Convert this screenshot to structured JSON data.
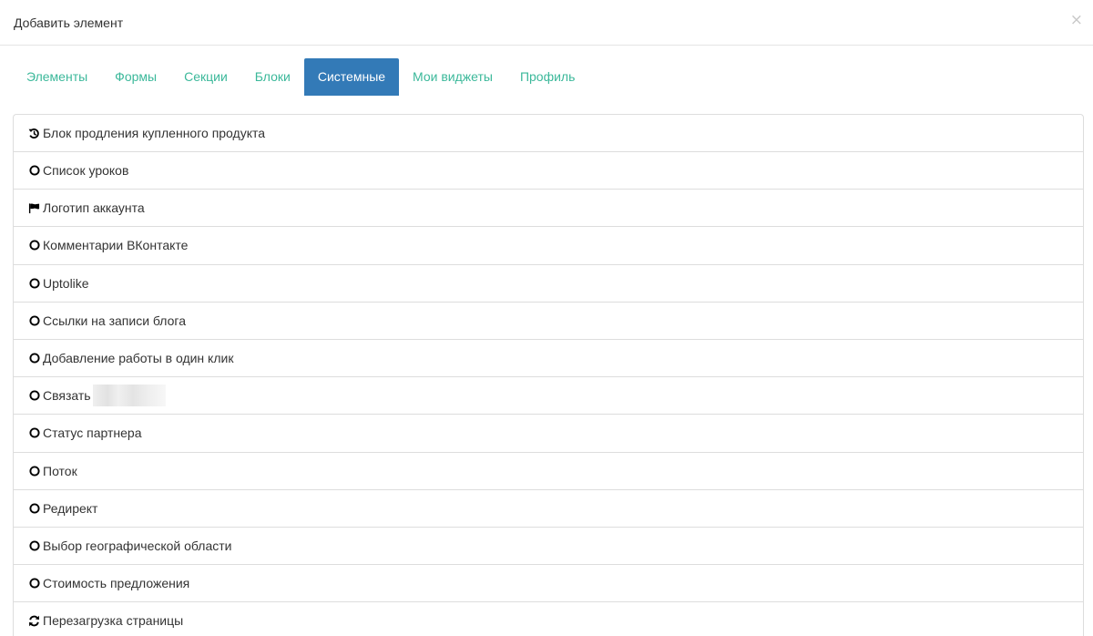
{
  "dialog": {
    "title": "Добавить элемент",
    "close_symbol": "×"
  },
  "tabs": [
    {
      "label": "Элементы",
      "active": false
    },
    {
      "label": "Формы",
      "active": false
    },
    {
      "label": "Секции",
      "active": false
    },
    {
      "label": "Блоки",
      "active": false
    },
    {
      "label": "Системные",
      "active": true
    },
    {
      "label": "Мои виджеты",
      "active": false
    },
    {
      "label": "Профиль",
      "active": false
    }
  ],
  "items": [
    {
      "label": "Блок продления купленного продукта",
      "icon": "history-icon"
    },
    {
      "label": "Список уроков",
      "icon": "circle-icon"
    },
    {
      "label": "Логотип аккаунта",
      "icon": "flag-icon"
    },
    {
      "label": "Комментарии ВКонтакте",
      "icon": "circle-icon"
    },
    {
      "label": "Uptolike",
      "icon": "circle-icon"
    },
    {
      "label": "Ссылки на записи блога",
      "icon": "circle-icon"
    },
    {
      "label": "Добавление работы в один клик",
      "icon": "circle-icon"
    },
    {
      "label": "Связать",
      "icon": "circle-icon",
      "redacted": true
    },
    {
      "label": "Статус партнера",
      "icon": "circle-icon"
    },
    {
      "label": "Поток",
      "icon": "circle-icon"
    },
    {
      "label": "Редирект",
      "icon": "circle-icon"
    },
    {
      "label": "Выбор географической области",
      "icon": "circle-icon"
    },
    {
      "label": "Стоимость предложения",
      "icon": "circle-icon"
    },
    {
      "label": "Перезагрузка страницы",
      "icon": "refresh-icon"
    }
  ],
  "colors": {
    "tab_text": "#3bb89a",
    "tab_active_bg": "#337ab7",
    "border": "#dddddd"
  }
}
